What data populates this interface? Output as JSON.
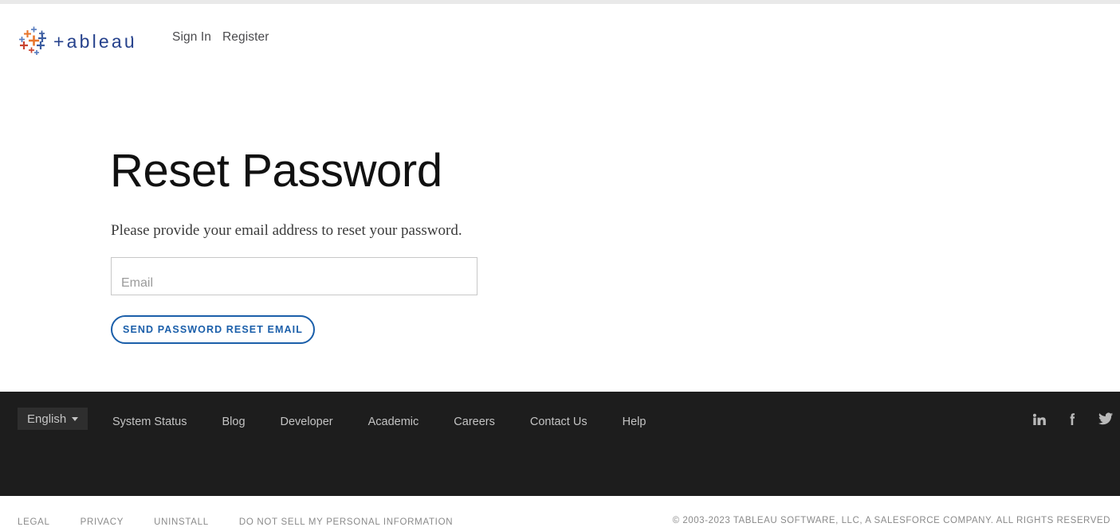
{
  "header": {
    "logo_alt": "tableau",
    "logo_wordmark": "+ableau",
    "links": [
      {
        "label": "Sign In",
        "name": "sign-in-link"
      },
      {
        "label": "Register",
        "name": "register-link"
      }
    ]
  },
  "main": {
    "title": "Reset Password",
    "subtitle": "Please provide your email address to reset your password.",
    "email_placeholder": "Email",
    "email_value": "",
    "submit_label": "SEND PASSWORD RESET EMAIL"
  },
  "footer": {
    "language": "English",
    "nav": [
      {
        "label": "System Status"
      },
      {
        "label": "Blog"
      },
      {
        "label": "Developer"
      },
      {
        "label": "Academic"
      },
      {
        "label": "Careers"
      },
      {
        "label": "Contact Us"
      },
      {
        "label": "Help"
      }
    ],
    "social": [
      {
        "name": "linkedin-icon",
        "label": "LinkedIn"
      },
      {
        "name": "facebook-icon",
        "label": "Facebook"
      },
      {
        "name": "twitter-icon",
        "label": "Twitter"
      }
    ],
    "legal": [
      {
        "label": "LEGAL"
      },
      {
        "label": "PRIVACY"
      },
      {
        "label": "UNINSTALL"
      },
      {
        "label": "DO NOT SELL MY PERSONAL INFORMATION"
      }
    ],
    "copyright": "© 2003-2023 TABLEAU SOFTWARE, LLC, A SALESFORCE COMPANY. ALL RIGHTS RESERVED"
  },
  "colors": {
    "brand_blue": "#1b5faa",
    "footer_bg": "#1d1d1d",
    "logo_orange": "#e8762d",
    "logo_blue": "#3b5ca0",
    "logo_red": "#c9432f"
  }
}
